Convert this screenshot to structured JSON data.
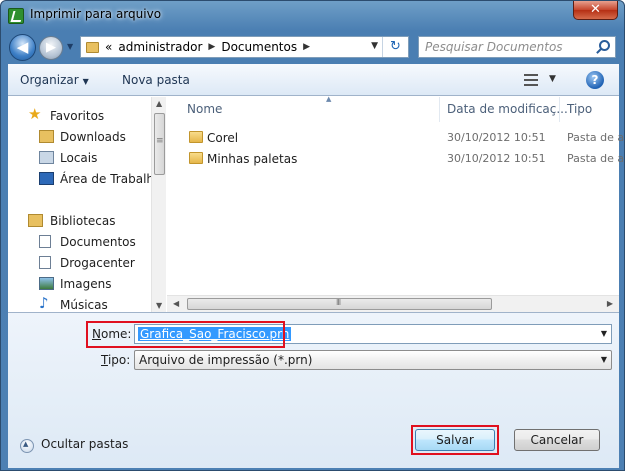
{
  "window": {
    "title": "Imprimir para arquivo",
    "close_glyph": "✕"
  },
  "nav": {
    "back_glyph": "◀",
    "forward_glyph": "▶",
    "breadcrumb": [
      "«",
      "administrador",
      "Documentos"
    ],
    "search_placeholder": "Pesquisar Documentos"
  },
  "toolbar": {
    "organize": "Organizar",
    "new_folder": "Nova pasta",
    "help_glyph": "?"
  },
  "sidebar": {
    "favorites": {
      "label": "Favoritos",
      "items": [
        "Downloads",
        "Locais",
        "Área de Trabalho"
      ]
    },
    "libraries": {
      "label": "Bibliotecas",
      "items": [
        "Documentos",
        "Drogacenter",
        "Imagens",
        "Músicas"
      ]
    }
  },
  "files": {
    "columns": [
      "Nome",
      "Data de modificaç...",
      "Tipo"
    ],
    "rows": [
      {
        "name": "Corel",
        "date": "30/10/2012 10:51",
        "type": "Pasta de a"
      },
      {
        "name": "Minhas paletas",
        "date": "30/10/2012 10:51",
        "type": "Pasta de a"
      }
    ]
  },
  "form": {
    "name_label_u": "N",
    "name_label_rest": "ome:",
    "name_value": "Grafica_Sao_Fracisco.prn",
    "type_label_u": "T",
    "type_label_rest": "ipo:",
    "type_value": "Arquivo de impressão (*.prn)"
  },
  "footer": {
    "hide_folders": "Ocultar pastas",
    "save_label": "Salvar",
    "cancel_label": "Cancelar"
  },
  "colors": {
    "highlight": "#e0101f",
    "selection": "#3399ff",
    "frame": "#4a7eb2"
  }
}
